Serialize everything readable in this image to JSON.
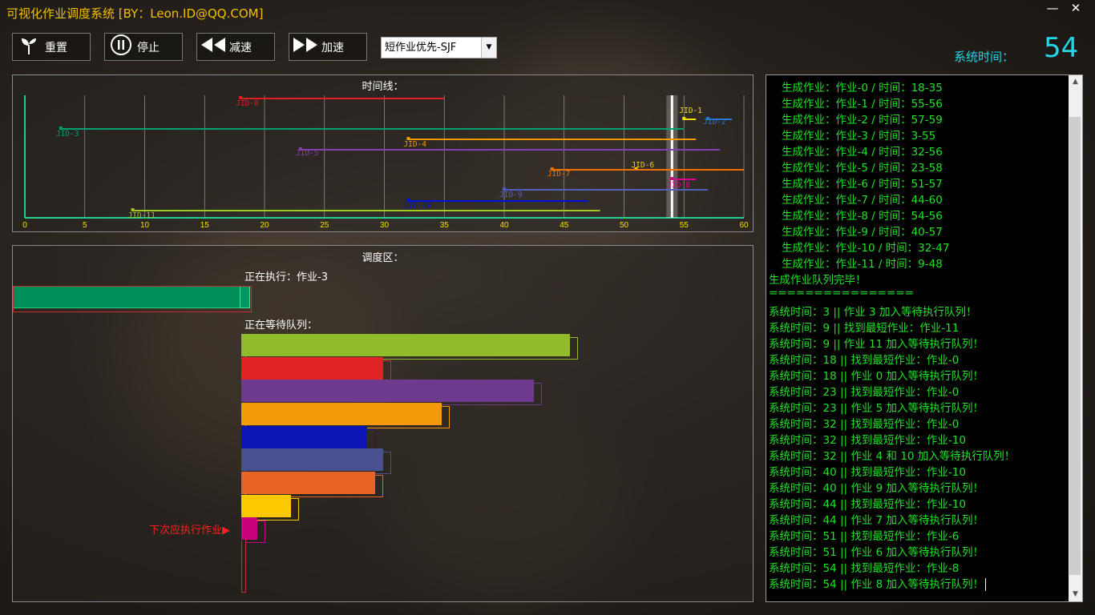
{
  "window": {
    "title": "可视化作业调度系统 [BY：Leon.ID@QQ.COM]",
    "minimize": "—",
    "close": "✕"
  },
  "toolbar": {
    "reset": "重置",
    "stop": "停止",
    "slow": "减速",
    "fast": "加速",
    "algorithm": "短作业优先-SJF"
  },
  "system_time": {
    "label": "系统时间：",
    "value": "54"
  },
  "timeline": {
    "title": "时间线：",
    "xlim": [
      0,
      60
    ],
    "current_time": 54,
    "ticks": [
      "0",
      "5",
      "10",
      "15",
      "20",
      "25",
      "30",
      "35",
      "40",
      "45",
      "50",
      "55",
      "60"
    ],
    "jobs": [
      {
        "label": "JID-0",
        "start": 18,
        "end": 35,
        "color": "#e02020"
      },
      {
        "label": "JID-1",
        "start": 55,
        "end": 56,
        "color": "#f0e000"
      },
      {
        "label": "JID-2",
        "start": 57,
        "end": 59,
        "color": "#2878d8"
      },
      {
        "label": "JID-3",
        "start": 3,
        "end": 55,
        "color": "#00a070"
      },
      {
        "label": "JID-4",
        "start": 32,
        "end": 56,
        "color": "#f09800"
      },
      {
        "label": "JID-5",
        "start": 23,
        "end": 58,
        "color": "#8040b0"
      },
      {
        "label": "JID-6",
        "start": 51,
        "end": 57,
        "color": "#f0d000"
      },
      {
        "label": "JID-7",
        "start": 44,
        "end": 60,
        "color": "#f07000"
      },
      {
        "label": "JID-8",
        "start": 54,
        "end": 56,
        "color": "#e00090"
      },
      {
        "label": "JID-9",
        "start": 40,
        "end": 57,
        "color": "#5060c0"
      },
      {
        "label": "JID-10",
        "start": 32,
        "end": 47,
        "color": "#0010e0"
      },
      {
        "label": "JID-11",
        "start": 9,
        "end": 48,
        "color": "#a0c820"
      }
    ]
  },
  "schedule": {
    "title": "调度区：",
    "running_label": "正在执行：作业-3",
    "waiting_label": "正在等待队列：",
    "next_label": "下次应执行作业▶",
    "queue": [
      {
        "color": "#8fbc28",
        "length": 410
      },
      {
        "color": "#e02424",
        "length": 177
      },
      {
        "color": "#6e3a8e",
        "length": 365
      },
      {
        "color": "#f49a0a",
        "length": 250
      },
      {
        "color": "#0c14b4",
        "length": 157
      },
      {
        "color": "#485090",
        "length": 177
      },
      {
        "color": "#e86424",
        "length": 167
      },
      {
        "color": "#fcc800",
        "length": 62
      },
      {
        "color": "#c8007c",
        "length": 20
      }
    ]
  },
  "log": {
    "lines": [
      "生成作业：作业-0 / 时间：18-35",
      "生成作业：作业-1 / 时间：55-56",
      "生成作业：作业-2 / 时间：57-59",
      "生成作业：作业-3 / 时间：3-55",
      "生成作业：作业-4 / 时间：32-56",
      "生成作业：作业-5 / 时间：23-58",
      "生成作业：作业-6 / 时间：51-57",
      "生成作业：作业-7 / 时间：44-60",
      "生成作业：作业-8 / 时间：54-56",
      "生成作业：作业-9 / 时间：40-57",
      "生成作业：作业-10 / 时间：32-47",
      "生成作业：作业-11 / 时间：9-48",
      "生成作业队列完毕！",
      "================",
      "系统时间：3 || 作业 3 加入等待执行队列！",
      "系统时间：9 || 找到最短作业：作业-11",
      "系统时间：9 || 作业 11 加入等待执行队列！",
      "系统时间：18 || 找到最短作业：作业-0",
      "系统时间：18 || 作业 0 加入等待执行队列！",
      "系统时间：23 || 找到最短作业：作业-0",
      "系统时间：23 || 作业 5 加入等待执行队列！",
      "系统时间：32 || 找到最短作业：作业-0",
      "系统时间：32 || 找到最短作业：作业-10",
      "系统时间：32 || 作业 4 和 10 加入等待执行队列！",
      "系统时间：40 || 找到最短作业：作业-10",
      "系统时间：40 || 作业 9 加入等待执行队列！",
      "系统时间：44 || 找到最短作业：作业-10",
      "系统时间：44 || 作业 7 加入等待执行队列！",
      "系统时间：51 || 找到最短作业：作业-6",
      "系统时间：51 || 作业 6 加入等待执行队列！",
      "系统时间：54 || 找到最短作业：作业-8",
      "系统时间：54 || 作业 8 加入等待执行队列！"
    ]
  }
}
